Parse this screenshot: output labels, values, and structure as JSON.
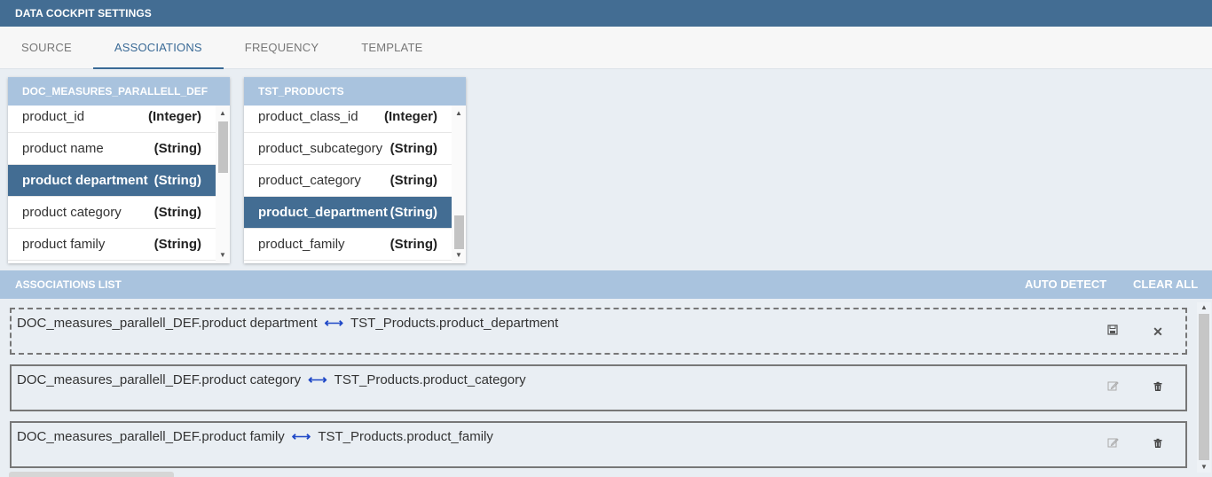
{
  "title": "DATA COCKPIT SETTINGS",
  "tabs": [
    {
      "label": "SOURCE"
    },
    {
      "label": "ASSOCIATIONS"
    },
    {
      "label": "FREQUENCY"
    },
    {
      "label": "TEMPLATE"
    }
  ],
  "active_tab": "ASSOCIATIONS",
  "left_table": {
    "name": "DOC_MEASURES_PARALLELL_DEF",
    "fields": [
      {
        "name": "product_id",
        "type": "(Integer)"
      },
      {
        "name": "product name",
        "type": "(String)"
      },
      {
        "name": "product department",
        "type": "(String)"
      },
      {
        "name": "product category",
        "type": "(String)"
      },
      {
        "name": "product family",
        "type": "(String)"
      }
    ],
    "selected_field": "product department"
  },
  "right_table": {
    "name": "TST_PRODUCTS",
    "fields": [
      {
        "name": "product_class_id",
        "type": "(Integer)"
      },
      {
        "name": "product_subcategory",
        "type": "(String)"
      },
      {
        "name": "product_category",
        "type": "(String)"
      },
      {
        "name": "product_department",
        "type": "(String)"
      },
      {
        "name": "product_family",
        "type": "(String)"
      }
    ],
    "selected_field": "product_department"
  },
  "associations_list": {
    "label": "ASSOCIATIONS LIST",
    "auto_detect_label": "AUTO DETECT",
    "clear_all_label": "CLEAR ALL",
    "items": [
      {
        "left": "DOC_measures_parallell_DEF.product department",
        "right": "TST_Products.product_department",
        "state": "editing",
        "action_icon": "save-icon",
        "secondary_icon": "close-icon"
      },
      {
        "left": "DOC_measures_parallell_DEF.product category",
        "right": "TST_Products.product_category",
        "state": "saved",
        "action_icon": "edit-icon",
        "secondary_icon": "trash-icon"
      },
      {
        "left": "DOC_measures_parallell_DEF.product family",
        "right": "TST_Products.product_family",
        "state": "saved",
        "action_icon": "edit-icon",
        "secondary_icon": "trash-icon"
      }
    ]
  },
  "colors": {
    "header": "#436d93",
    "subheader": "#a9c3de",
    "selected_row": "#436d93",
    "association_arrow": "#1f48c7",
    "background": "#e9eef3"
  }
}
